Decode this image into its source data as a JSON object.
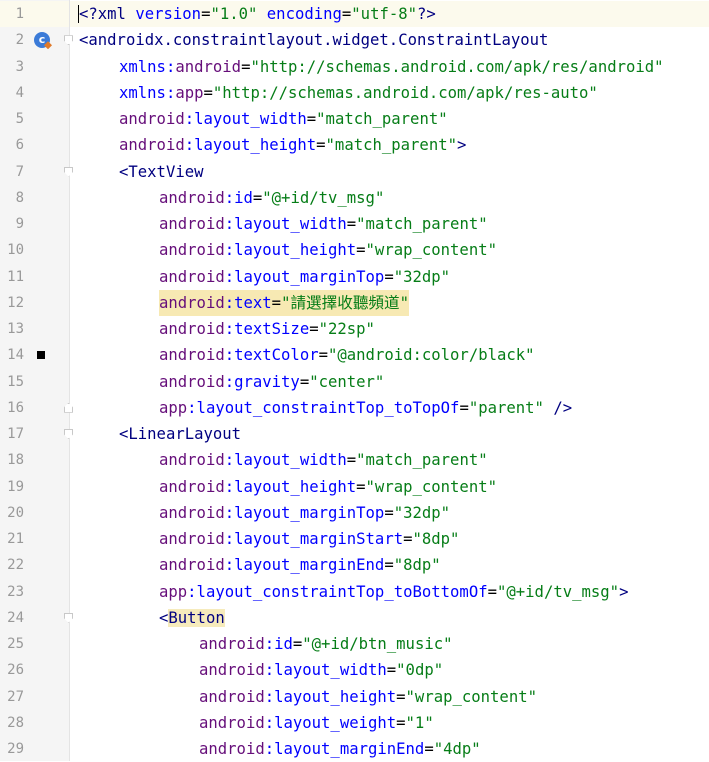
{
  "editor": {
    "active_line": 1,
    "lines": [
      {
        "n": "1",
        "indent": 0,
        "tokens": [
          {
            "t": "",
            "s": "caret"
          },
          {
            "t": "<?xml ",
            "s": "tag"
          },
          {
            "t": "version",
            "s": "attr"
          },
          {
            "t": "=",
            "s": "eq"
          },
          {
            "t": "\"1.0\"",
            "s": "val"
          },
          {
            "t": " ",
            "s": "tag"
          },
          {
            "t": "encoding",
            "s": "attr"
          },
          {
            "t": "=",
            "s": "eq"
          },
          {
            "t": "\"utf-8\"",
            "s": "val"
          },
          {
            "t": "?>",
            "s": "tag"
          }
        ]
      },
      {
        "n": "2",
        "indent": 0,
        "fold": "open",
        "gutter_icon": "c",
        "tokens": [
          {
            "t": "<androidx.constraintlayout.widget.ConstraintLayout",
            "s": "tag"
          }
        ]
      },
      {
        "n": "3",
        "indent": 1,
        "tokens": [
          {
            "t": "xmlns:",
            "s": "attr"
          },
          {
            "t": "android",
            "s": "ns"
          },
          {
            "t": "=",
            "s": "eq"
          },
          {
            "t": "\"http://schemas.android.com/apk/res/android\"",
            "s": "val"
          }
        ]
      },
      {
        "n": "4",
        "indent": 1,
        "tokens": [
          {
            "t": "xmlns:",
            "s": "attr"
          },
          {
            "t": "app",
            "s": "ns"
          },
          {
            "t": "=",
            "s": "eq"
          },
          {
            "t": "\"http://schemas.android.com/apk/res-auto\"",
            "s": "val"
          }
        ]
      },
      {
        "n": "5",
        "indent": 1,
        "tokens": [
          {
            "t": "android",
            "s": "ns"
          },
          {
            "t": ":layout_width",
            "s": "attr"
          },
          {
            "t": "=",
            "s": "eq"
          },
          {
            "t": "\"match_parent\"",
            "s": "val"
          }
        ]
      },
      {
        "n": "6",
        "indent": 1,
        "tokens": [
          {
            "t": "android",
            "s": "ns"
          },
          {
            "t": ":layout_height",
            "s": "attr"
          },
          {
            "t": "=",
            "s": "eq"
          },
          {
            "t": "\"match_parent\"",
            "s": "val"
          },
          {
            "t": ">",
            "s": "tag"
          }
        ]
      },
      {
        "n": "7",
        "indent": 1,
        "fold": "open",
        "tokens": [
          {
            "t": "<TextView",
            "s": "tag"
          }
        ]
      },
      {
        "n": "8",
        "indent": 2,
        "tokens": [
          {
            "t": "android",
            "s": "ns"
          },
          {
            "t": ":id",
            "s": "attr"
          },
          {
            "t": "=",
            "s": "eq"
          },
          {
            "t": "\"@+id/tv_msg\"",
            "s": "val"
          }
        ]
      },
      {
        "n": "9",
        "indent": 2,
        "tokens": [
          {
            "t": "android",
            "s": "ns"
          },
          {
            "t": ":layout_width",
            "s": "attr"
          },
          {
            "t": "=",
            "s": "eq"
          },
          {
            "t": "\"match_parent\"",
            "s": "val"
          }
        ]
      },
      {
        "n": "10",
        "indent": 2,
        "tokens": [
          {
            "t": "android",
            "s": "ns"
          },
          {
            "t": ":layout_height",
            "s": "attr"
          },
          {
            "t": "=",
            "s": "eq"
          },
          {
            "t": "\"wrap_content\"",
            "s": "val"
          }
        ]
      },
      {
        "n": "11",
        "indent": 2,
        "tokens": [
          {
            "t": "android",
            "s": "ns"
          },
          {
            "t": ":layout_marginTop",
            "s": "attr"
          },
          {
            "t": "=",
            "s": "eq"
          },
          {
            "t": "\"32dp\"",
            "s": "val"
          }
        ]
      },
      {
        "n": "12",
        "indent": 2,
        "highlight": true,
        "tokens": [
          {
            "t": "android",
            "s": "ns"
          },
          {
            "t": ":text",
            "s": "attr"
          },
          {
            "t": "=",
            "s": "eq"
          },
          {
            "t": "\"請選擇收聽頻道\"",
            "s": "val"
          }
        ]
      },
      {
        "n": "13",
        "indent": 2,
        "tokens": [
          {
            "t": "android",
            "s": "ns"
          },
          {
            "t": ":textSize",
            "s": "attr"
          },
          {
            "t": "=",
            "s": "eq"
          },
          {
            "t": "\"22sp\"",
            "s": "val"
          }
        ]
      },
      {
        "n": "14",
        "indent": 2,
        "bookmark": true,
        "tokens": [
          {
            "t": "android",
            "s": "ns"
          },
          {
            "t": ":textColor",
            "s": "attr"
          },
          {
            "t": "=",
            "s": "eq"
          },
          {
            "t": "\"@android:color/black\"",
            "s": "val"
          }
        ]
      },
      {
        "n": "15",
        "indent": 2,
        "tokens": [
          {
            "t": "android",
            "s": "ns"
          },
          {
            "t": ":gravity",
            "s": "attr"
          },
          {
            "t": "=",
            "s": "eq"
          },
          {
            "t": "\"center\"",
            "s": "val"
          }
        ]
      },
      {
        "n": "16",
        "indent": 2,
        "fold": "close",
        "tokens": [
          {
            "t": "app",
            "s": "ns"
          },
          {
            "t": ":layout_constraintTop_toTopOf",
            "s": "attr"
          },
          {
            "t": "=",
            "s": "eq"
          },
          {
            "t": "\"parent\"",
            "s": "val"
          },
          {
            "t": " />",
            "s": "tag"
          }
        ]
      },
      {
        "n": "17",
        "indent": 1,
        "fold": "open",
        "tokens": [
          {
            "t": "<LinearLayout",
            "s": "tag"
          }
        ]
      },
      {
        "n": "18",
        "indent": 2,
        "tokens": [
          {
            "t": "android",
            "s": "ns"
          },
          {
            "t": ":layout_width",
            "s": "attr"
          },
          {
            "t": "=",
            "s": "eq"
          },
          {
            "t": "\"match_parent\"",
            "s": "val"
          }
        ]
      },
      {
        "n": "19",
        "indent": 2,
        "tokens": [
          {
            "t": "android",
            "s": "ns"
          },
          {
            "t": ":layout_height",
            "s": "attr"
          },
          {
            "t": "=",
            "s": "eq"
          },
          {
            "t": "\"wrap_content\"",
            "s": "val"
          }
        ]
      },
      {
        "n": "20",
        "indent": 2,
        "tokens": [
          {
            "t": "android",
            "s": "ns"
          },
          {
            "t": ":layout_marginTop",
            "s": "attr"
          },
          {
            "t": "=",
            "s": "eq"
          },
          {
            "t": "\"32dp\"",
            "s": "val"
          }
        ]
      },
      {
        "n": "21",
        "indent": 2,
        "tokens": [
          {
            "t": "android",
            "s": "ns"
          },
          {
            "t": ":layout_marginStart",
            "s": "attr"
          },
          {
            "t": "=",
            "s": "eq"
          },
          {
            "t": "\"8dp\"",
            "s": "val"
          }
        ]
      },
      {
        "n": "22",
        "indent": 2,
        "tokens": [
          {
            "t": "android",
            "s": "ns"
          },
          {
            "t": ":layout_marginEnd",
            "s": "attr"
          },
          {
            "t": "=",
            "s": "eq"
          },
          {
            "t": "\"8dp\"",
            "s": "val"
          }
        ]
      },
      {
        "n": "23",
        "indent": 2,
        "tokens": [
          {
            "t": "app",
            "s": "ns"
          },
          {
            "t": ":layout_constraintTop_toBottomOf",
            "s": "attr"
          },
          {
            "t": "=",
            "s": "eq"
          },
          {
            "t": "\"@+id/tv_msg\"",
            "s": "val"
          },
          {
            "t": ">",
            "s": "tag"
          }
        ]
      },
      {
        "n": "24",
        "indent": 2,
        "fold": "open",
        "tokens": [
          {
            "t": "<",
            "s": "tag"
          },
          {
            "t": "Button",
            "s": "hltag"
          }
        ]
      },
      {
        "n": "25",
        "indent": 3,
        "tokens": [
          {
            "t": "android",
            "s": "ns"
          },
          {
            "t": ":id",
            "s": "attr"
          },
          {
            "t": "=",
            "s": "eq"
          },
          {
            "t": "\"@+id/btn_music\"",
            "s": "val"
          }
        ]
      },
      {
        "n": "26",
        "indent": 3,
        "tokens": [
          {
            "t": "android",
            "s": "ns"
          },
          {
            "t": ":layout_width",
            "s": "attr"
          },
          {
            "t": "=",
            "s": "eq"
          },
          {
            "t": "\"0dp\"",
            "s": "val"
          }
        ]
      },
      {
        "n": "27",
        "indent": 3,
        "tokens": [
          {
            "t": "android",
            "s": "ns"
          },
          {
            "t": ":layout_height",
            "s": "attr"
          },
          {
            "t": "=",
            "s": "eq"
          },
          {
            "t": "\"wrap_content\"",
            "s": "val"
          }
        ]
      },
      {
        "n": "28",
        "indent": 3,
        "tokens": [
          {
            "t": "android",
            "s": "ns"
          },
          {
            "t": ":layout_weight",
            "s": "attr"
          },
          {
            "t": "=",
            "s": "eq"
          },
          {
            "t": "\"1\"",
            "s": "val"
          }
        ]
      },
      {
        "n": "29",
        "indent": 3,
        "tokens": [
          {
            "t": "android",
            "s": "ns"
          },
          {
            "t": ":layout_marginEnd",
            "s": "attr"
          },
          {
            "t": "=",
            "s": "eq"
          },
          {
            "t": "\"4dp\"",
            "s": "val"
          }
        ]
      }
    ]
  }
}
